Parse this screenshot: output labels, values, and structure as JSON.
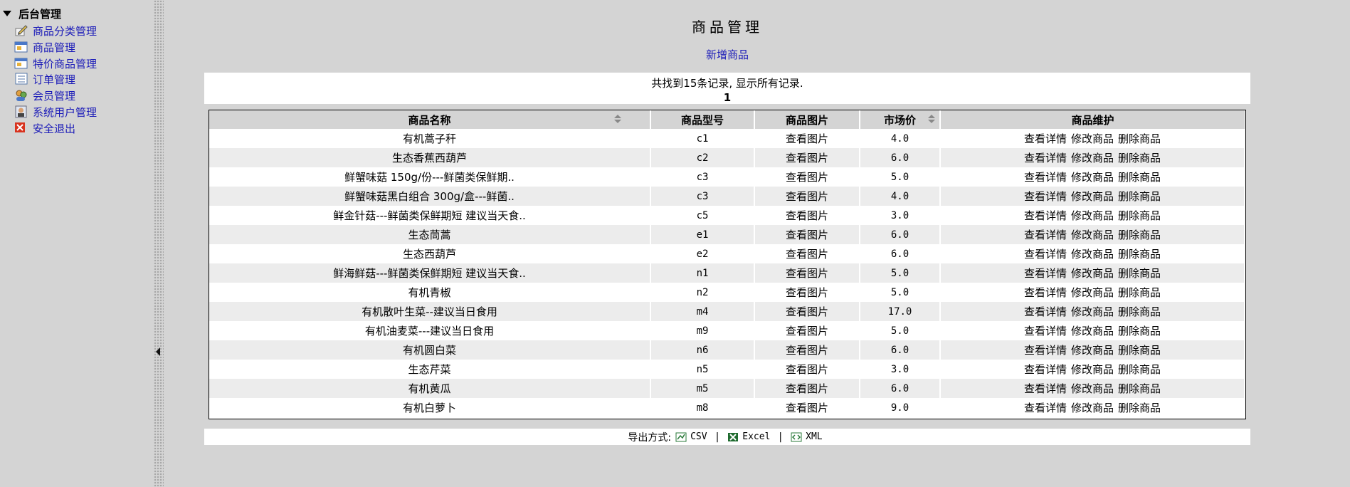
{
  "sidebar": {
    "root": "后台管理",
    "items": [
      {
        "label": "商品分类管理",
        "icon": "edit-pencil-icon"
      },
      {
        "label": "商品管理",
        "icon": "window-icon"
      },
      {
        "label": "特价商品管理",
        "icon": "window-icon"
      },
      {
        "label": "订单管理",
        "icon": "list-icon"
      },
      {
        "label": "会员管理",
        "icon": "users-icon"
      },
      {
        "label": "系统用户管理",
        "icon": "user-icon"
      },
      {
        "label": "安全退出",
        "icon": "close-icon"
      }
    ]
  },
  "main": {
    "title": "商品管理",
    "add_link": "新增商品",
    "summary": "共找到15条记录, 显示所有记录.",
    "page": "1",
    "columns": [
      "商品名称",
      "商品型号",
      "商品图片",
      "市场价",
      "商品维护"
    ],
    "actions": [
      "查看详情",
      "修改商品",
      "删除商品"
    ],
    "view_image": "查看图片",
    "rows": [
      {
        "name": "有机蒿子秆",
        "model": "c1",
        "price": "4.0"
      },
      {
        "name": "生态香蕉西葫芦",
        "model": "c2",
        "price": "6.0"
      },
      {
        "name": "鲜蟹味菇 150g/份---鲜菌类保鲜期..",
        "model": "c3",
        "price": "5.0"
      },
      {
        "name": "鲜蟹味菇黑白组合 300g/盒---鲜菌..",
        "model": "c3",
        "price": "4.0"
      },
      {
        "name": "鲜金针菇---鲜菌类保鲜期短 建议当天食..",
        "model": "c5",
        "price": "3.0"
      },
      {
        "name": "生态茼蒿",
        "model": "e1",
        "price": "6.0"
      },
      {
        "name": "生态西葫芦",
        "model": "e2",
        "price": "6.0"
      },
      {
        "name": "鲜海鲜菇---鲜菌类保鲜期短 建议当天食..",
        "model": "n1",
        "price": "5.0"
      },
      {
        "name": "有机青椒",
        "model": "n2",
        "price": "5.0"
      },
      {
        "name": "有机散叶生菜--建议当日食用",
        "model": "m4",
        "price": "17.0"
      },
      {
        "name": "有机油麦菜---建议当日食用",
        "model": "m9",
        "price": "5.0"
      },
      {
        "name": "有机圆白菜",
        "model": "n6",
        "price": "6.0"
      },
      {
        "name": "生态芹菜",
        "model": "n5",
        "price": "3.0"
      },
      {
        "name": "有机黄瓜",
        "model": "m5",
        "price": "6.0"
      },
      {
        "name": "有机白萝卜",
        "model": "m8",
        "price": "9.0"
      }
    ],
    "export": {
      "label": "导出方式:",
      "csv": "CSV",
      "excel": "Excel",
      "xml": "XML",
      "separator": "|"
    }
  },
  "colors": {
    "background": "#d4d4d4",
    "link": "#1a1ab8",
    "header_bg": "#d4d4d4",
    "alt_row": "#ececec"
  }
}
